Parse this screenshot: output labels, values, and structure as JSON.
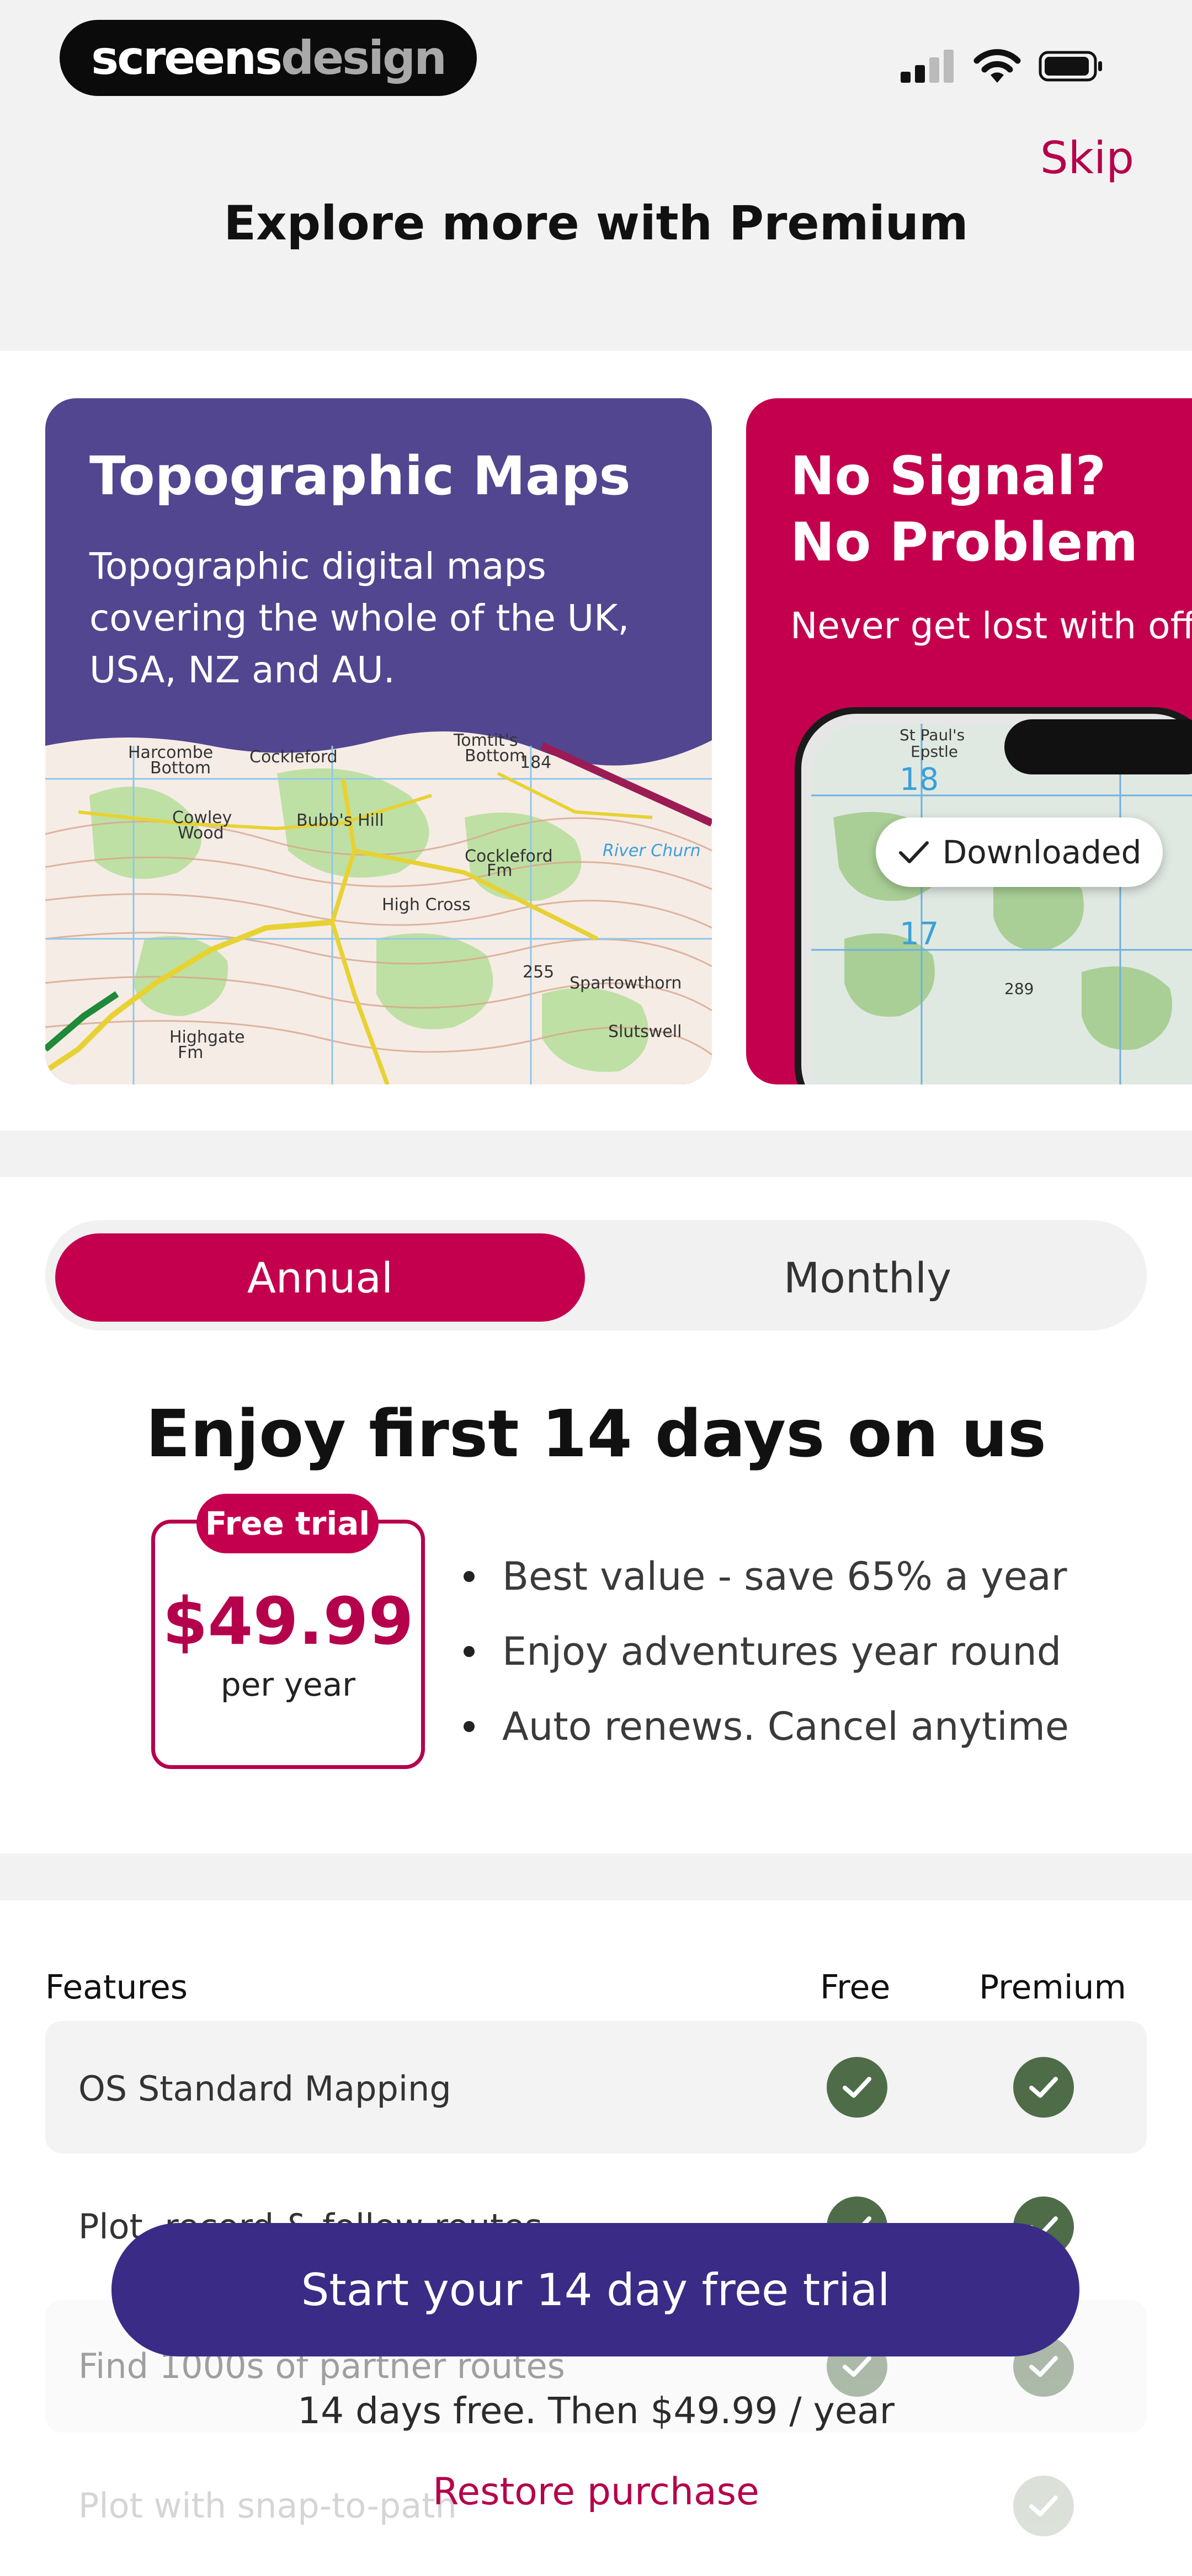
{
  "status_bar": {
    "logo_primary": "screens",
    "logo_secondary": "design",
    "icons": [
      "signal-icon",
      "wifi-icon",
      "battery-icon"
    ]
  },
  "header": {
    "skip_label": "Skip",
    "title": "Explore more with Premium"
  },
  "cards": [
    {
      "title": "Topographic Maps",
      "text": "Topographic digital maps covering the whole of the UK, USA, NZ and AU.",
      "color": "#524690"
    },
    {
      "title_line1": "No Signal?",
      "title_line2": "No Problem",
      "text": "Never get lost with offline maps",
      "badge": "Downloaded",
      "color": "#c4004e"
    }
  ],
  "plan_toggle": {
    "annual": "Annual",
    "monthly": "Monthly",
    "selected": "Annual"
  },
  "offer": {
    "heading": "Enjoy first 14 days on us",
    "badge": "Free trial",
    "price": "$49.99",
    "period": "per year",
    "bullets": [
      "Best value - save 65% a year",
      "Enjoy adventures year round",
      "Auto renews. Cancel anytime"
    ]
  },
  "features": {
    "header_features": "Features",
    "header_free": "Free",
    "header_premium": "Premium",
    "rows": [
      {
        "label": "OS Standard Mapping",
        "free": true,
        "premium": true
      },
      {
        "label": "Plot, record & follow routes",
        "free": true,
        "premium": true
      },
      {
        "label": "Find 1000s of partner routes",
        "free": true,
        "premium": true
      },
      {
        "label": "Plot with snap-to-path",
        "free": false,
        "premium": true
      }
    ]
  },
  "cta": {
    "button": "Start your 14 day free trial",
    "subtext": "14 days free. Then $49.99 / year",
    "restore": "Restore purchase"
  },
  "colors": {
    "accent": "#c4004e",
    "cta": "#3a2b86",
    "check": "#4e6c48"
  }
}
